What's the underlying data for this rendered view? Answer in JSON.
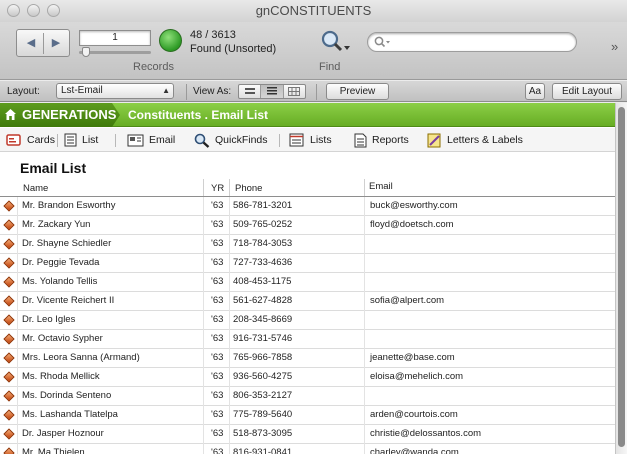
{
  "window": {
    "title": "gnCONSTITUENTS"
  },
  "toolbar": {
    "record_number": "1",
    "records_label": "Records",
    "count": "48 / 3613",
    "found_status": "Found (Unsorted)",
    "find_label": "Find",
    "search_placeholder": "",
    "overflow": "»"
  },
  "layout_bar": {
    "layout_label": "Layout:",
    "layout_value": "Lst-Email",
    "view_as_label": "View As:",
    "preview_label": "Preview",
    "font_button_label": "Aa",
    "edit_layout_label": "Edit Layout"
  },
  "brand": {
    "name": "GENERATIONS",
    "breadcrumb": "Constituents . Email List"
  },
  "nav": {
    "items": [
      {
        "label": "Cards",
        "icon": "cards-icon"
      },
      {
        "label": "List",
        "icon": "list-icon"
      },
      {
        "label": "Email",
        "icon": "email-icon"
      },
      {
        "label": "QuickFinds",
        "icon": "magnifier-icon"
      },
      {
        "label": "Lists",
        "icon": "lists-icon"
      },
      {
        "label": "Reports",
        "icon": "reports-icon"
      },
      {
        "label": "Letters & Labels",
        "icon": "letters-icon"
      }
    ]
  },
  "list": {
    "title": "Email List",
    "columns": {
      "name": "Name",
      "yr": "YR",
      "phone": "Phone",
      "email": "Email"
    },
    "rows": [
      {
        "name": "Mr. Brandon Esworthy",
        "yr": "'63",
        "phone": "586-781-3201",
        "email": "buck@esworthy.com"
      },
      {
        "name": "Mr. Zackary Yun",
        "yr": "'63",
        "phone": "509-765-0252",
        "email": "floyd@doetsch.com"
      },
      {
        "name": "Dr. Shayne Schiedler",
        "yr": "'63",
        "phone": "718-784-3053",
        "email": ""
      },
      {
        "name": "Dr. Peggie Tevada",
        "yr": "'63",
        "phone": "727-733-4636",
        "email": ""
      },
      {
        "name": "Ms. Yolando Tellis",
        "yr": "'63",
        "phone": "408-453-1175",
        "email": ""
      },
      {
        "name": "Dr. Vicente Reichert II",
        "yr": "'63",
        "phone": "561-627-4828",
        "email": "sofia@alpert.com"
      },
      {
        "name": "Dr. Leo Igles",
        "yr": "'63",
        "phone": "208-345-8669",
        "email": ""
      },
      {
        "name": "Mr. Octavio Sypher",
        "yr": "'63",
        "phone": "916-731-5746",
        "email": ""
      },
      {
        "name": "Mrs. Leora Sanna (Armand)",
        "yr": "'63",
        "phone": "765-966-7858",
        "email": "jeanette@base.com"
      },
      {
        "name": "Ms. Rhoda Mellick",
        "yr": "'63",
        "phone": "936-560-4275",
        "email": "eloisa@mehelich.com"
      },
      {
        "name": "Ms. Dorinda Senteno",
        "yr": "'63",
        "phone": "806-353-2127",
        "email": ""
      },
      {
        "name": "Ms. Lashanda Tlatelpa",
        "yr": "'63",
        "phone": "775-789-5640",
        "email": "arden@courtois.com"
      },
      {
        "name": "Dr. Jasper Hoznour",
        "yr": "'63",
        "phone": "518-873-3095",
        "email": "christie@delossantos.com"
      },
      {
        "name": "Mr. Ma Thielen",
        "yr": "'63",
        "phone": "816-931-0841",
        "email": "charley@wanda.com"
      }
    ]
  },
  "colors": {
    "brand_green": "#7bbf36",
    "brand_dark": "#4e8c12",
    "diamond": "#d85a16"
  }
}
